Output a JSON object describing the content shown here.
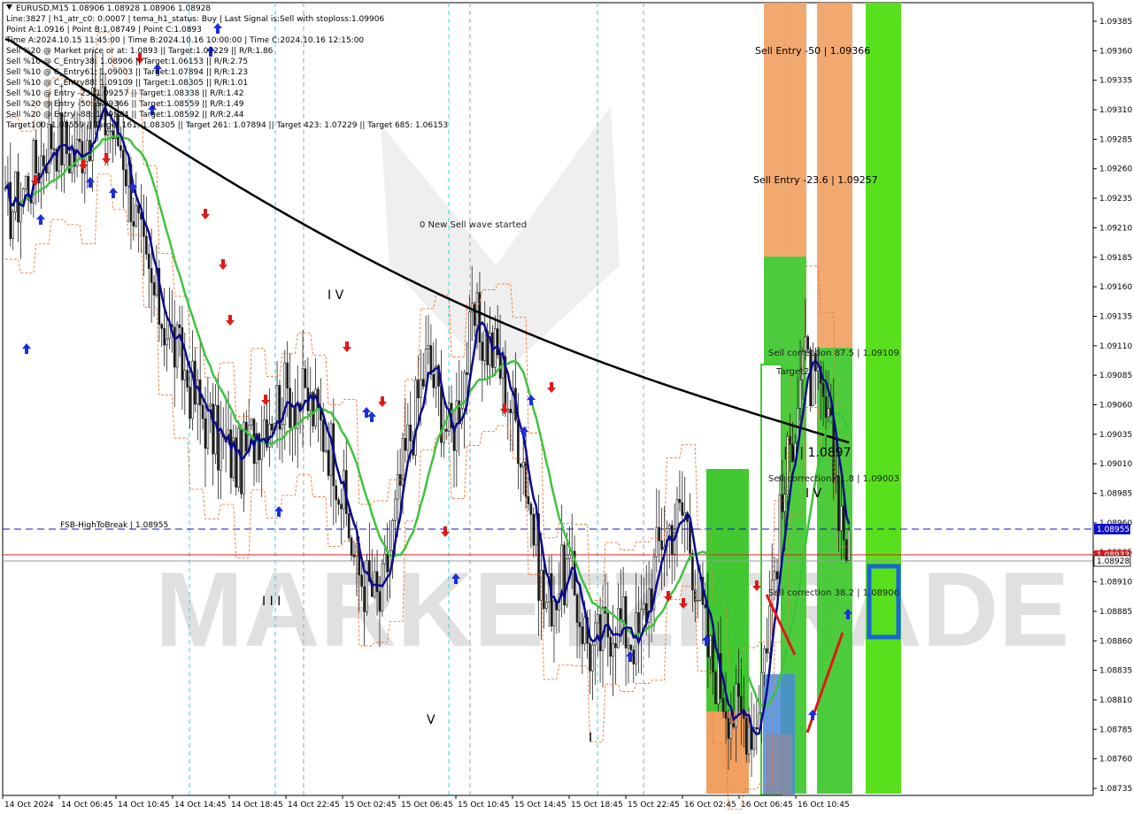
{
  "info_lines": [
    "EURUSD,M15  1.08906 1.08928 1.08906 1.08928",
    "Line:3827  |  h1_atr_c0: 0.0007  |  tema_h1_status: Buy  |  Last Signal is:Sell with stoploss:1.09906",
    "Point A:1.0916  |  Point B:1.08749  |  Point C:1.0893",
    "Time A:2024.10.15 11:45:00  |  Time B:2024.10.16 10:00:00  |  Time C:2024.10.16 12:15:00",
    "Sell %20 @ Market price or at: 1.0893  ||  Target:1.07229  ||  R/R:1.86",
    "Sell %10 @ C_Entry38: 1.08906  ||  Target:1.06153  ||  R/R:2.75",
    "Sell %10 @ C_Entry61: 1.09003  ||  Target:1.07894  ||  R/R:1.23",
    "Sell %10 @ C_Entry88: 1.09109  ||  Target:1.08305  ||  R/R:1.01",
    "Sell %10 @ Entry -23: 1.09257  ||  Target:1.08338  ||  R/R:1.42",
    "Sell %20 @ Entry -50: 1.09366  ||  Target:1.08559  ||  R/R:1.49",
    "Sell %20 @ Entry -88: 1.09524  ||  Target:1.08592  ||  R/R:2.44",
    "Target100: 1.08559  ||  Target 161: 1.08305  ||  Target 261: 1.07894  ||  Target 423: 1.07229  ||  Target 685: 1.06153"
  ],
  "y_axis": [
    "1.09385",
    "1.09360",
    "1.09335",
    "1.09310",
    "1.09285",
    "1.09260",
    "1.09235",
    "1.09210",
    "1.09185",
    "1.09160",
    "1.09135",
    "1.09110",
    "1.09085",
    "1.09060",
    "1.09035",
    "1.09010",
    "1.08985",
    "1.08960",
    "1.08935",
    "1.08910",
    "1.08885",
    "1.08860",
    "1.08835",
    "1.08810",
    "1.08785",
    "1.08760",
    "1.08735"
  ],
  "x_axis": [
    "14 Oct 2024",
    "14 Oct 06:45",
    "14 Oct 10:45",
    "14 Oct 14:45",
    "14 Oct 18:45",
    "14 Oct 22:45",
    "15 Oct 02:45",
    "15 Oct 06:45",
    "15 Oct 10:45",
    "15 Oct 14:45",
    "15 Oct 18:45",
    "15 Oct 22:45",
    "16 Oct 02:45",
    "16 Oct 06:45",
    "16 Oct 10:45"
  ],
  "price_tags": {
    "fsb": "1.08955",
    "red": "1.08933",
    "current": "1.08928"
  },
  "annotations": {
    "sell_entry_50": "Sell Entry -50 | 1.09366",
    "sell_entry_236": "Sell Entry -23.6 | 1.09257",
    "sell_correction_875": "Sell correction 87.5 | 1.09109",
    "sell_correction_618": "Sell correction 61.8 | 1.09003",
    "sell_correction_382": "Sell correction 38.2 | 1.08906",
    "target_label": "Target2",
    "new_wave": "0 New Sell wave started",
    "fsb_label": "FSB-HighToBreak | 1.08955",
    "wave_price": "| | | 1.0897",
    "wave_iv_top": "I V",
    "wave_iv_right": "I V",
    "wave_v": "V",
    "wave_i": "I",
    "wave_iii": "I I I"
  },
  "watermark": "MARKETZITRADE",
  "colors": {
    "ema_black": "#000000",
    "ema_green": "#3ec43e",
    "ema_navy": "#0a0a8c",
    "band_orange": "#f07838",
    "bar_green": "#58e01c",
    "zone_orange": "#f0a060",
    "zone_green": "#42c932",
    "fsb_line": "#1010c8",
    "price_line": "#d81e1e",
    "grid_cyan": "#30d8d8"
  },
  "chart_data": {
    "type": "candlestick",
    "symbol": "EURUSD",
    "timeframe": "M15",
    "ohlc_last": {
      "open": 1.08906,
      "high": 1.08928,
      "low": 1.08906,
      "close": 1.08928
    },
    "ylim": [
      1.08725,
      1.09395
    ],
    "levels": {
      "fsb_high_to_break": 1.08955,
      "current_price": 1.08928,
      "red_line": 1.08933,
      "sell_entry_50": 1.09366,
      "sell_entry_236": 1.09257,
      "sell_correction_875": 1.09109,
      "sell_correction_618": 1.09003,
      "sell_correction_382": 1.08906
    },
    "x": [
      "14 Oct 2024",
      "14 Oct 06:45",
      "14 Oct 10:45",
      "14 Oct 14:45",
      "14 Oct 18:45",
      "14 Oct 22:45",
      "15 Oct 02:45",
      "15 Oct 06:45",
      "15 Oct 10:45",
      "15 Oct 14:45",
      "15 Oct 18:45",
      "15 Oct 22:45",
      "16 Oct 02:45",
      "16 Oct 06:45",
      "16 Oct 10:45"
    ],
    "close_path": [
      1.0922,
      1.0925,
      1.0929,
      1.0927,
      1.0931,
      1.0928,
      1.0917,
      1.0912,
      1.0907,
      1.0903,
      1.0901,
      1.0905,
      1.0907,
      1.0906,
      1.0902,
      1.0892,
      1.0889,
      1.0901,
      1.091,
      1.0903,
      1.0913,
      1.091,
      1.0903,
      1.0889,
      1.0892,
      1.0885,
      1.0888,
      1.0886,
      1.0895,
      1.0897,
      1.0885,
      1.088,
      1.0879,
      1.0895,
      1.091,
      1.0905,
      1.0893
    ]
  }
}
